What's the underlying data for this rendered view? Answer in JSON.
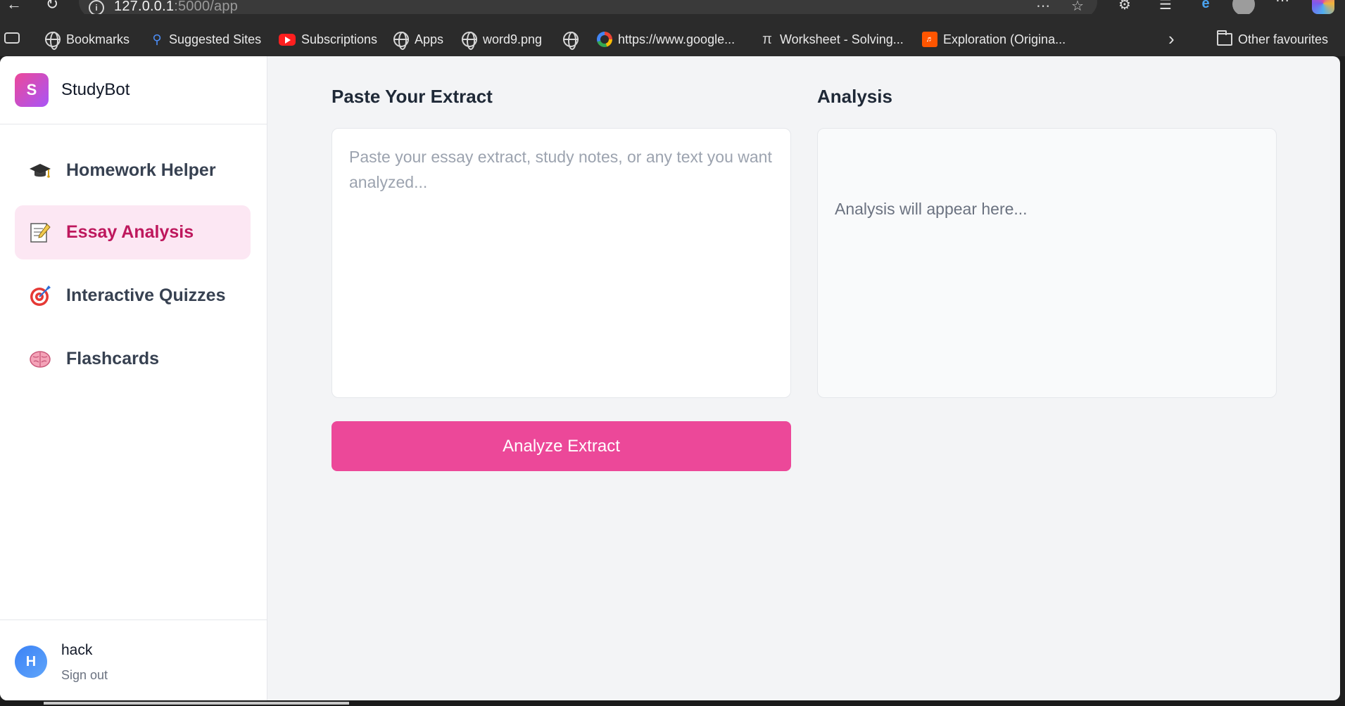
{
  "browser": {
    "url_host": "127.0.0.1",
    "url_rest": ":5000/app",
    "bookmarks": [
      {
        "label": "Bookmarks",
        "icon": "globe-icon"
      },
      {
        "label": "Suggested Sites",
        "icon": "search-icon"
      },
      {
        "label": "Subscriptions",
        "icon": "youtube-icon"
      },
      {
        "label": "Apps",
        "icon": "globe-icon"
      },
      {
        "label": "word9.png",
        "icon": "globe-icon"
      },
      {
        "label": "",
        "icon": "globe-icon"
      },
      {
        "label": "https://www.google...",
        "icon": "google-icon"
      },
      {
        "label": "Worksheet - Solving...",
        "icon": "pi-icon"
      },
      {
        "label": "Exploration (Origina...",
        "icon": "soundcloud-icon"
      }
    ],
    "other_favourites": "Other favourites"
  },
  "sidebar": {
    "brand_initial": "S",
    "brand_name": "StudyBot",
    "items": [
      {
        "label": "Homework Helper",
        "icon": "graduation-cap-icon",
        "active": false
      },
      {
        "label": "Essay Analysis",
        "icon": "memo-icon",
        "active": true
      },
      {
        "label": "Interactive Quizzes",
        "icon": "target-icon",
        "active": false
      },
      {
        "label": "Flashcards",
        "icon": "brain-icon",
        "active": false
      }
    ],
    "user": {
      "initial": "H",
      "name": "hack",
      "signout": "Sign out"
    }
  },
  "main": {
    "extract_title": "Paste Your Extract",
    "extract_placeholder": "Paste your essay extract, study notes, or any text you want analyzed...",
    "extract_value": "",
    "analysis_title": "Analysis",
    "analysis_placeholder": "Analysis will appear here...",
    "analyze_button": "Analyze Extract"
  },
  "colors": {
    "accent": "#ec4899",
    "active_bg": "#fce7f3",
    "active_text": "#be185d"
  }
}
